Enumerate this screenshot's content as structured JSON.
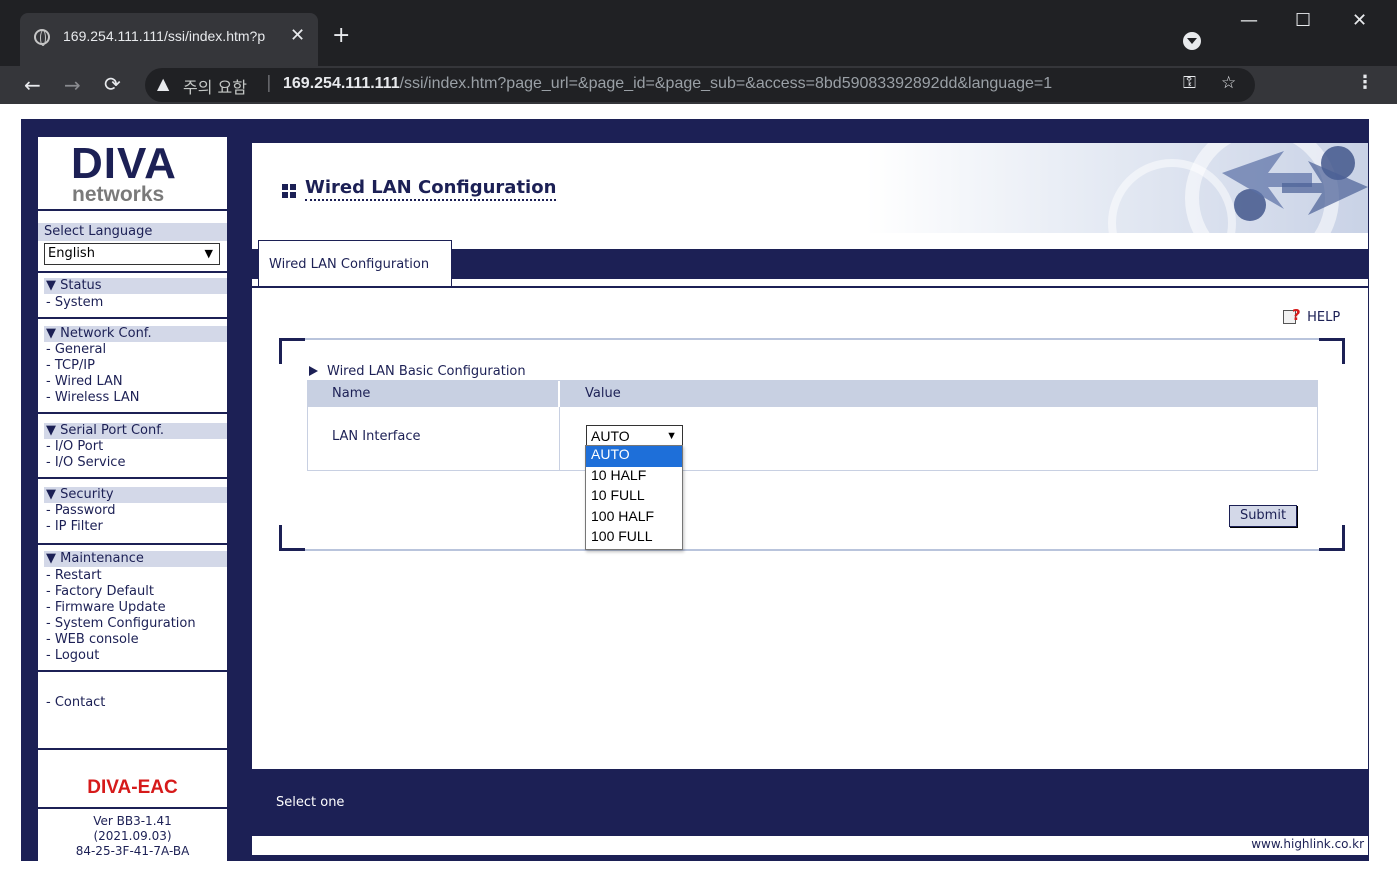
{
  "browser": {
    "tab_title": "169.254.111.111/ssi/index.htm?p",
    "new_tab": "+",
    "security_label": "주의 요함",
    "url_host": "169.254.111.111",
    "url_path": "/ssi/index.htm?page_url=&page_id=&page_sub=&access=8bd59083392892dd&language=1"
  },
  "sidebar": {
    "logo_main": "DIVA",
    "logo_sub": "networks",
    "language_label": "Select Language",
    "language_value": "English",
    "sections": [
      {
        "title": "▼ Status",
        "items": [
          "- System"
        ]
      },
      {
        "title": "▼ Network Conf.",
        "items": [
          "- General",
          "- TCP/IP",
          "- Wired LAN",
          "- Wireless LAN"
        ]
      },
      {
        "title": "▼ Serial Port Conf.",
        "items": [
          "- I/O Port",
          "- I/O Service"
        ]
      },
      {
        "title": "▼ Security",
        "items": [
          "- Password",
          "- IP Filter"
        ]
      },
      {
        "title": "▼ Maintenance",
        "items": [
          "- Restart",
          "- Factory Default",
          "- Firmware Update",
          "- System Configuration",
          "- WEB console",
          "- Logout"
        ]
      }
    ],
    "contact": "-  Contact",
    "product": "DIVA-EAC",
    "version": "Ver BB3-1.41",
    "date": "(2021.09.03)",
    "mac": "84-25-3F-41-7A-BA"
  },
  "main": {
    "page_title": "Wired LAN Configuration",
    "tab_label": "Wired LAN Configuration",
    "help_label": "HELP",
    "section_title": "Wired LAN Basic Configuration",
    "table": {
      "headers": [
        "Name",
        "Value"
      ],
      "rows": [
        {
          "name": "LAN Interface",
          "value": "AUTO"
        }
      ]
    },
    "dropdown_options": [
      "AUTO",
      "10 HALF",
      "10 FULL",
      "100 HALF",
      "100 FULL"
    ],
    "dropdown_selected": "AUTO",
    "submit_label": "Submit",
    "status_text": "Select one",
    "copyright": "www.highlink.co.kr"
  },
  "colors": {
    "navy": "#1c2055",
    "header_bg": "#c8d0e2",
    "selected_option": "#1e6fd9",
    "product_red": "#d61a1a"
  },
  "icons": [
    "globe-icon",
    "close-icon",
    "back-icon",
    "forward-icon",
    "reload-icon",
    "warning-icon",
    "key-icon",
    "star-icon",
    "kebab-menu-icon",
    "help-icon",
    "title-grid-icon",
    "triangle-bullet-icon",
    "chevron-down-icon"
  ]
}
